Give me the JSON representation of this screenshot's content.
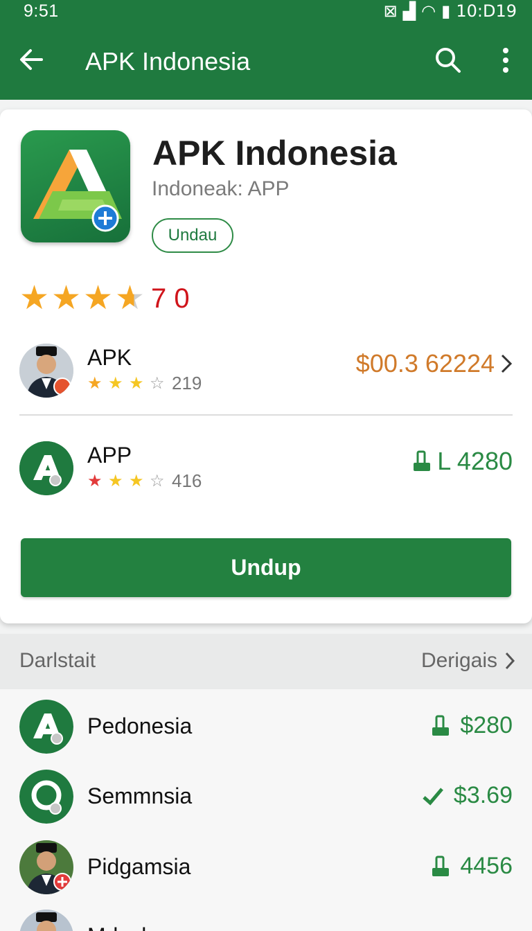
{
  "status": {
    "time": "9:51",
    "right_text": "10:D19"
  },
  "appbar": {
    "title": "APK Indonesia"
  },
  "app": {
    "name": "APK Indonesia",
    "subtitle": "Indoneak: APP",
    "pill_label": "Undau",
    "rating_value": 3.5,
    "rating_text": "7 0"
  },
  "listings": [
    {
      "name": "APK",
      "stars": 3,
      "count": "219",
      "price": "$00.3 62224",
      "price_color": "#d07a2a"
    },
    {
      "name": "APP",
      "stars": 3,
      "count": "416",
      "price": "L 4280",
      "price_color": "#2a8a44"
    }
  ],
  "main_button": {
    "label": "Undup"
  },
  "section": {
    "left": "Darlstait",
    "right": "Derigais"
  },
  "more_apps": [
    {
      "name": "Pedonesia",
      "price": "$280"
    },
    {
      "name": "Semmnsia",
      "price": "$3.69"
    },
    {
      "name": "Pidgamsia",
      "price": "4456"
    },
    {
      "name": "Mdesl...",
      "price": ""
    }
  ],
  "colors": {
    "brand": "#1f7a3f",
    "accent_orange": "#d07a2a",
    "accent_green": "#2a8a44",
    "rating_red": "#d0141b"
  }
}
